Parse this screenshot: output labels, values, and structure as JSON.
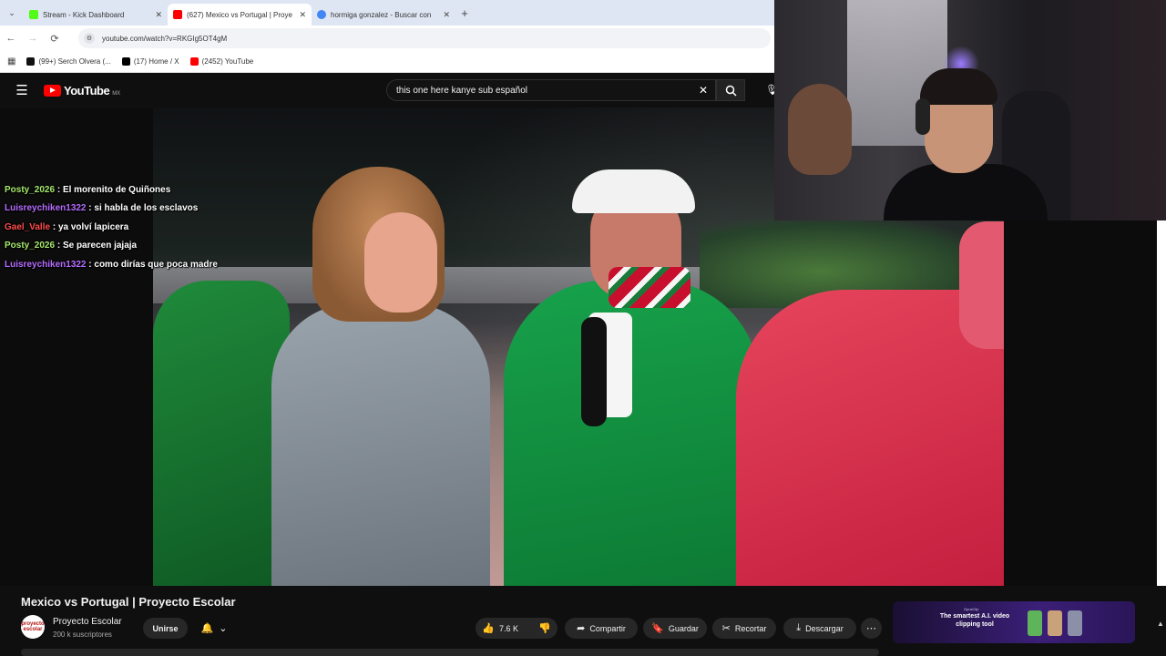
{
  "browser": {
    "tabs": [
      {
        "title": "Stream - Kick Dashboard",
        "favicon_color": "#53fc18"
      },
      {
        "title": "(627) Mexico vs Portugal | Proye",
        "favicon_color": "#ff0000"
      },
      {
        "title": "hormiga gonzalez - Buscar con",
        "favicon_color": "#4285f4"
      }
    ],
    "new_tab_label": "+",
    "url": "youtube.com/watch?v=RKGIg5OT4gM",
    "bookmarks": [
      {
        "title": "(99+) Serch Olvera (...",
        "favicon_color": "#111111"
      },
      {
        "title": "(17) Home / X",
        "favicon_color": "#000000"
      },
      {
        "title": "(2452) YouTube",
        "favicon_color": "#ff0000"
      }
    ]
  },
  "youtube": {
    "logo_text": "YouTube",
    "country_code": "MX",
    "search_query": "this one here kanye sub español"
  },
  "chat": [
    {
      "user": "Posty_2026",
      "user_color": "#a5e86b",
      "message": "El morenito de Quiñones"
    },
    {
      "user": "Luisreychiken1322",
      "user_color": "#b56cff",
      "message": "si habla de los esclavos"
    },
    {
      "user": "Gael_Valle",
      "user_color": "#ff4b4b",
      "message": "ya volví lapicera"
    },
    {
      "user": "Posty_2026",
      "user_color": "#a5e86b",
      "message": "Se parecen jajaja"
    },
    {
      "user": "Luisreychiken1322",
      "user_color": "#b56cff",
      "message": "como dirías que poca madre"
    }
  ],
  "video": {
    "title": "Mexico vs Portugal | Proyecto Escolar",
    "channel_name": "Proyecto Escolar",
    "channel_avatar_text": "proyecto escolar",
    "subscribers": "200 k suscriptores",
    "join_label": "Unirse",
    "like_count": "7.6 K",
    "share_label": "Compartir",
    "save_label": "Guardar",
    "clip_label": "Recortar",
    "download_label": "Descargar"
  },
  "ad": {
    "brand": "OpusClip",
    "headline": "The smartest A.I. video clipping tool"
  },
  "colors": {
    "youtube_red": "#ff0000",
    "dark_bg": "#0f0f0f",
    "pill_bg": "#272727"
  }
}
